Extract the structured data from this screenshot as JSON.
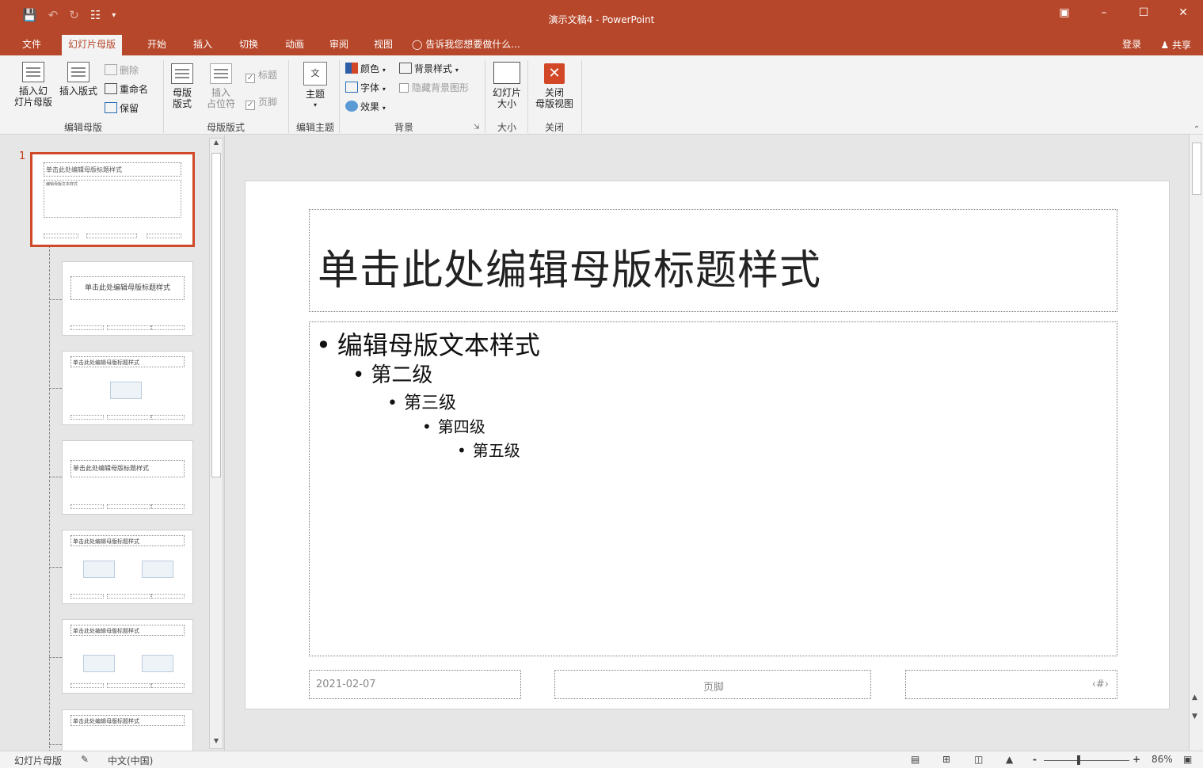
{
  "app": {
    "document_title": "演示文稿4 - PowerPoint",
    "colors": {
      "accent": "#b7472a",
      "ribbon_bg": "#f3f3f3",
      "selection": "#d04a2a",
      "close_red": "#d24726"
    }
  },
  "qat": {
    "save_icon": "save-icon",
    "undo_icon": "undo-icon",
    "redo_icon": "redo-icon",
    "present_icon": "present-from-start-icon",
    "customize_icon": "customize-qat-icon"
  },
  "window_controls": {
    "ribbon_display": "ribbon-display-options-icon",
    "minimize": "minimize-icon",
    "maximize": "maximize-icon",
    "close": "close-icon"
  },
  "tabs": [
    {
      "label": "文件"
    },
    {
      "label": "幻灯片母版",
      "active": true
    },
    {
      "label": "开始"
    },
    {
      "label": "插入"
    },
    {
      "label": "切换"
    },
    {
      "label": "动画"
    },
    {
      "label": "审阅"
    },
    {
      "label": "视图"
    }
  ],
  "tell_me": "告诉我您想要做什么...",
  "account": {
    "login": "登录",
    "share": "共享"
  },
  "ribbon": {
    "edit_master": {
      "label": "编辑母版",
      "insert_master": "插入幻\n灯片母版",
      "insert_layout": "插入版式",
      "delete": "删除",
      "rename": "重命名",
      "preserve": "保留"
    },
    "master_layout": {
      "label": "母版版式",
      "master_layout_btn": "母版\n版式",
      "insert_placeholder": "插入\n占位符",
      "title_chk": "标题",
      "footer_chk": "页脚"
    },
    "edit_theme": {
      "label": "编辑主题",
      "themes": "主题",
      "theme_glyph": "文"
    },
    "background": {
      "label": "背景",
      "colors": "颜色",
      "fonts": "字体",
      "effects": "效果",
      "bg_styles": "背景样式",
      "hide_bg": "隐藏背景图形"
    },
    "size": {
      "label": "大小",
      "slide_size": "幻灯片\n大小"
    },
    "close": {
      "label": "关闭",
      "close_master": "关闭\n母版视图"
    }
  },
  "thumbnails": {
    "master_number": "1",
    "master_title": "单击此处编辑母版标题样式",
    "master_body": "编辑母版文本样式",
    "layout2_title": "单击此处编辑母版标题样式",
    "layout3_title": "单击此处编辑母版标题样式",
    "layout4_title": "单击此处编辑母版标题样式",
    "layout5_title": "单击此处编辑母版标题样式",
    "layout6_title": "单击此处编辑母版标题样式",
    "layout7_title": "单击此处编辑母版标题样式"
  },
  "slide": {
    "title": "单击此处编辑母版标题样式",
    "levels": [
      "编辑母版文本样式",
      "第二级",
      "第三级",
      "第四级",
      "第五级"
    ],
    "bullet": "•",
    "date": "2021-02-07",
    "footer": "页脚",
    "slide_number": "‹#›"
  },
  "status": {
    "view_name": "幻灯片母版",
    "language": "中文(中国)",
    "zoom": "86%",
    "zoom_minus": "-",
    "zoom_plus": "+"
  }
}
